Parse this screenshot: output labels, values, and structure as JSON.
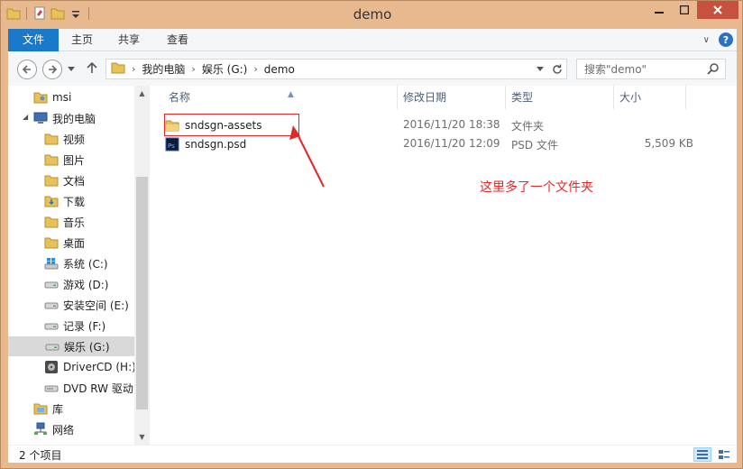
{
  "window": {
    "title": "demo"
  },
  "ribbon": {
    "tabs": [
      "文件",
      "主页",
      "共享",
      "查看"
    ]
  },
  "address": {
    "breadcrumb": [
      "我的电脑",
      "娱乐 (G:)",
      "demo"
    ]
  },
  "search": {
    "placeholder": "搜索\"demo\""
  },
  "nav": {
    "items": [
      {
        "label": "msi",
        "icon": "user-folder-icon"
      },
      {
        "label": "我的电脑",
        "icon": "computer-icon"
      },
      {
        "label": "视频",
        "icon": "folder-icon"
      },
      {
        "label": "图片",
        "icon": "folder-icon"
      },
      {
        "label": "文档",
        "icon": "folder-icon"
      },
      {
        "label": "下载",
        "icon": "download-folder-icon"
      },
      {
        "label": "音乐",
        "icon": "folder-icon"
      },
      {
        "label": "桌面",
        "icon": "folder-icon"
      },
      {
        "label": "系统 (C:)",
        "icon": "system-drive-icon"
      },
      {
        "label": "游戏 (D:)",
        "icon": "drive-icon"
      },
      {
        "label": "安装空间 (E:)",
        "icon": "drive-icon"
      },
      {
        "label": "记录 (F:)",
        "icon": "drive-icon"
      },
      {
        "label": "娱乐 (G:)",
        "icon": "drive-icon",
        "selected": true
      },
      {
        "label": "DriverCD (H:)",
        "icon": "cd-drive-icon"
      },
      {
        "label": "DVD RW 驱动",
        "icon": "dvd-drive-icon"
      },
      {
        "label": "库",
        "icon": "library-icon"
      },
      {
        "label": "网络",
        "icon": "network-icon"
      }
    ]
  },
  "table": {
    "headers": [
      "名称",
      "修改日期",
      "类型",
      "大小"
    ],
    "rows": [
      {
        "name": "sndsgn-assets",
        "modified": "2016/11/20 18:38",
        "type": "文件夹",
        "size": "",
        "icon": "folder-icon"
      },
      {
        "name": "sndsgn.psd",
        "modified": "2016/11/20 12:09",
        "type": "PSD 文件",
        "size": "5,509 KB",
        "icon": "psd-file-icon"
      }
    ]
  },
  "annotation": {
    "text": "这里多了一个文件夹",
    "color": "#e02a2a"
  },
  "status": {
    "count": "2 个项目"
  },
  "colors": {
    "accent": "#1979ca",
    "frame": "#e8b98f",
    "close": "#c7503f"
  }
}
